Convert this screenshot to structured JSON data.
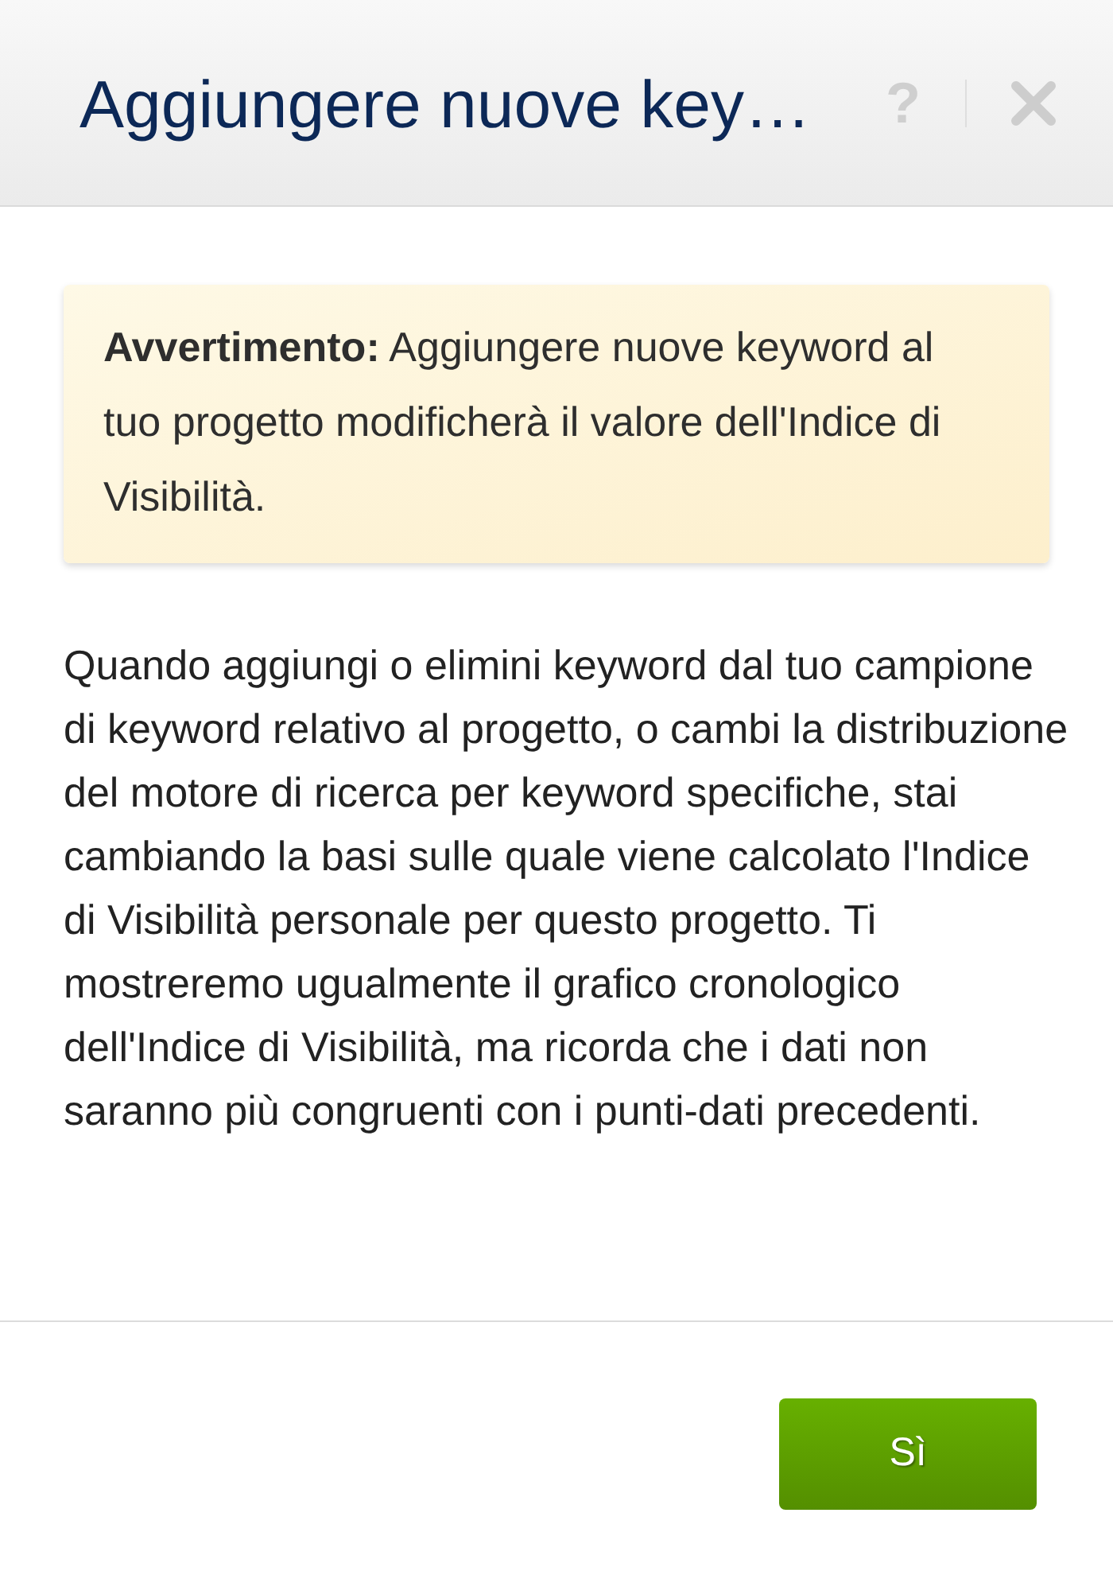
{
  "dialog": {
    "title": "Aggiungere nuove key…",
    "help_button": {
      "label": "?"
    }
  },
  "warning": {
    "text": "**Avvertimento:** Aggiungere nuove keyword al tuo progetto modificherà il valore dell'Indice di Visibilità."
  },
  "body": {
    "text": "Quando aggiungi o elimini keyword dal tuo campione di keyword relativo al progetto, o cambi la distribuzione del motore di ricerca per keyword specifiche, stai cambiando la basi sulle quale viene calcolato l'Indice di Visibilità personale per questo progetto. Ti mostreremo ugualmente il grafico cronologico dell'Indice di Visibilità, ma ricorda che i dati non saranno più congruenti con i punti-dati precedenti."
  },
  "buttons": [
    {
      "label": "Sì"
    }
  ]
}
